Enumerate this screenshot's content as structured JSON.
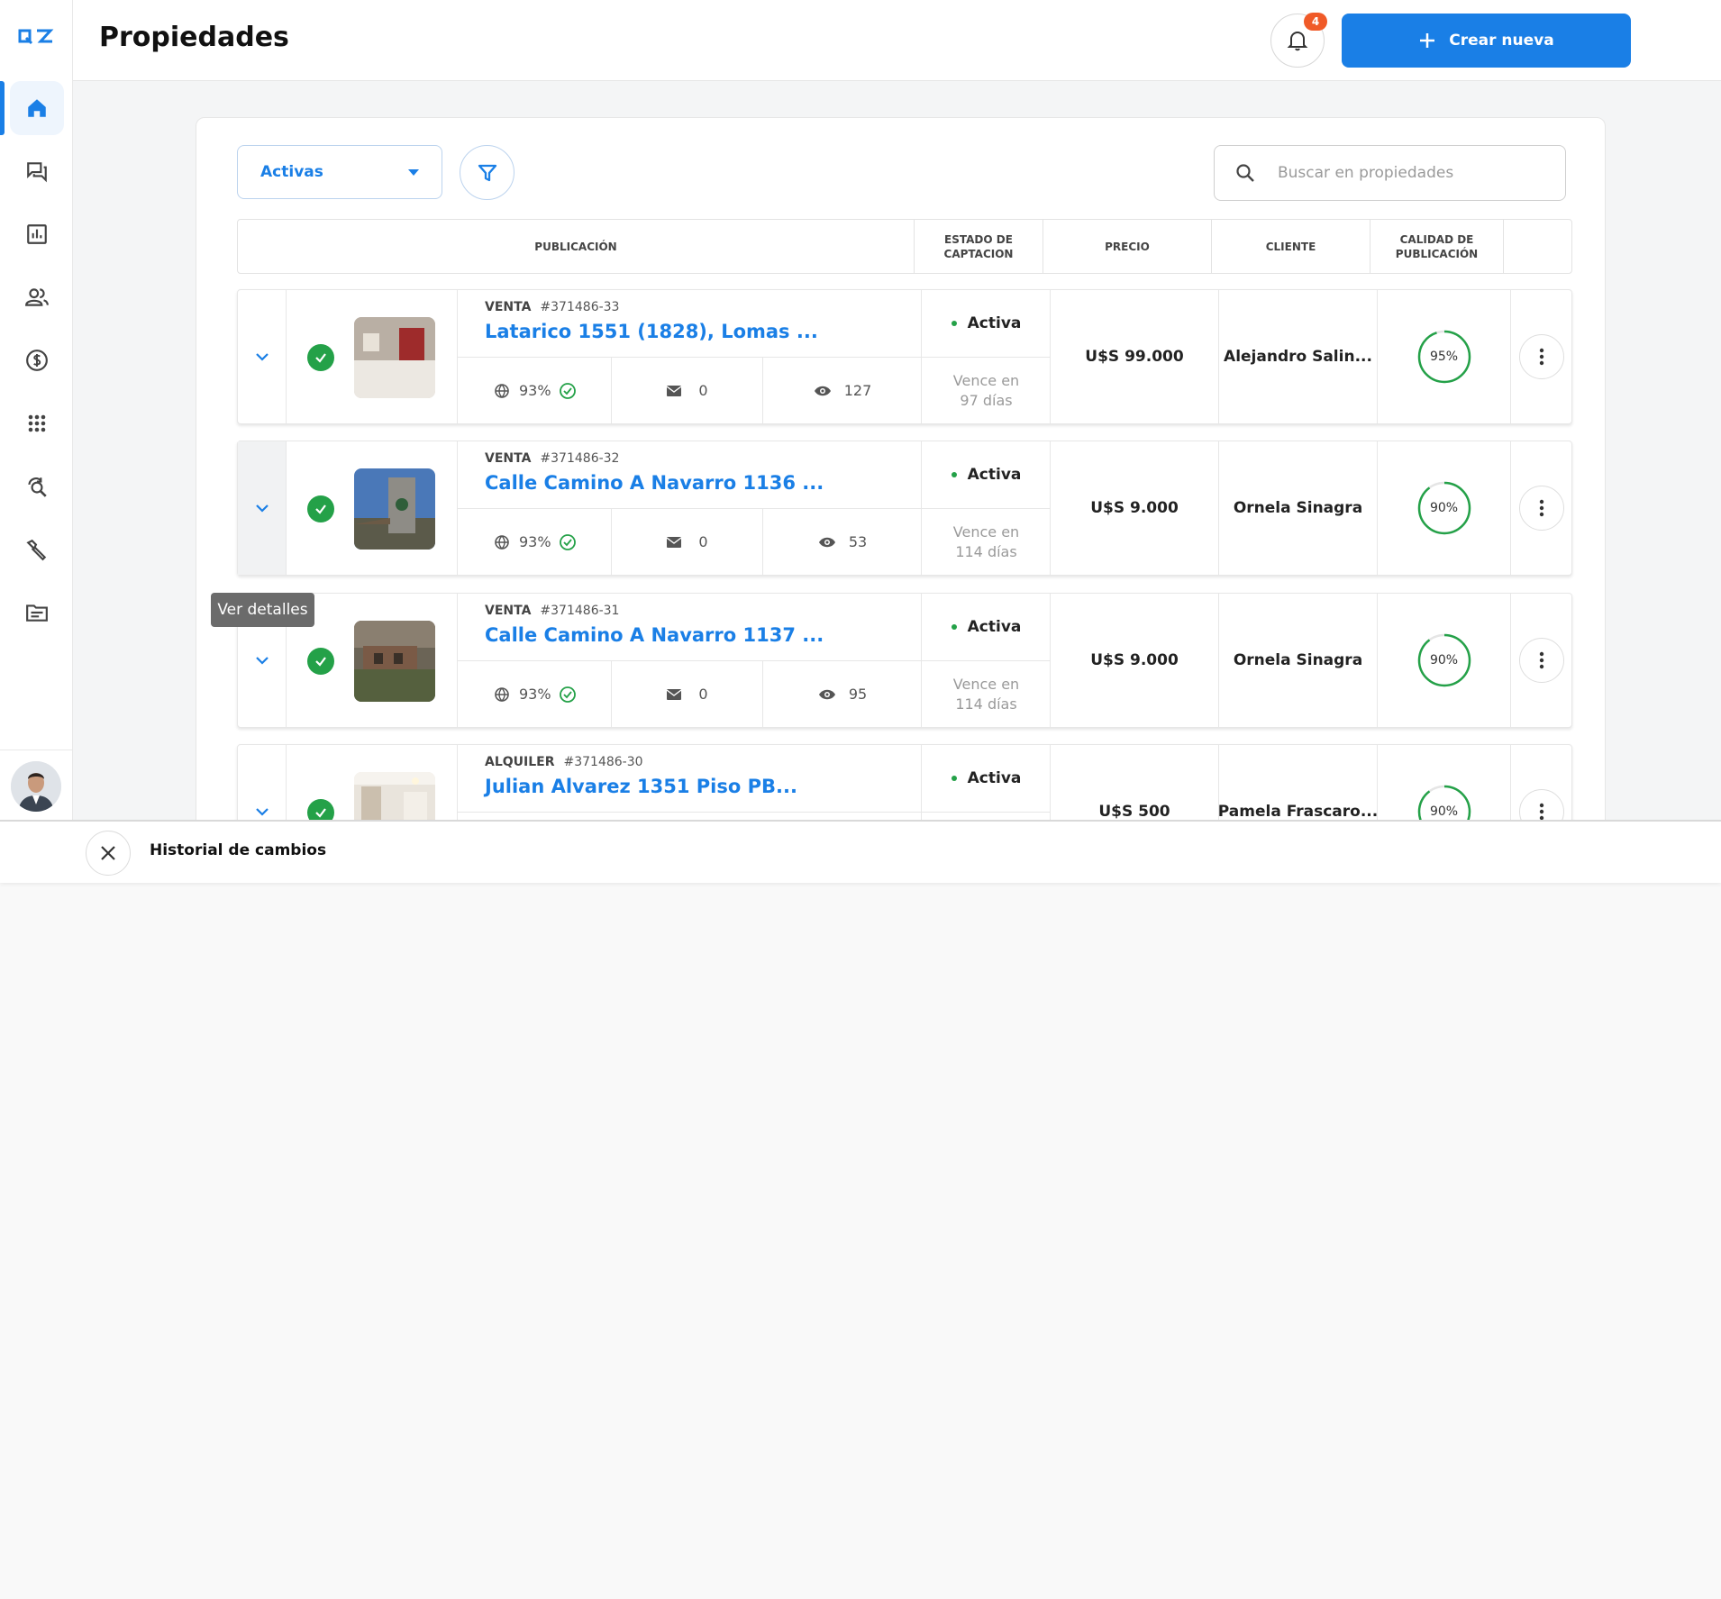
{
  "header": {
    "title": "Propiedades",
    "notifications_count": "4",
    "create_label": "Crear nueva"
  },
  "sidebar": {
    "items": [
      {
        "icon": "home-icon",
        "active": true
      },
      {
        "icon": "chat-icon"
      },
      {
        "icon": "reports-icon"
      },
      {
        "icon": "contacts-icon"
      },
      {
        "icon": "dollar-icon"
      },
      {
        "icon": "apps-icon"
      },
      {
        "icon": "search-sync-icon"
      },
      {
        "icon": "tools-icon"
      },
      {
        "icon": "documents-icon"
      }
    ]
  },
  "toolbar": {
    "status_filter": "Activas",
    "search_placeholder": "Buscar en propiedades"
  },
  "table": {
    "columns": [
      "PUBLICACIÓN",
      "ESTADO DE CAPTACION",
      "PRECIO",
      "CLIENTE",
      "CALIDAD DE PUBLICACIÓN"
    ],
    "rows": [
      {
        "operation": "VENTA",
        "code": "#371486-33",
        "address": "Latarico 1551 (1828), Lomas ...",
        "quality_web": "93%",
        "messages": "0",
        "views": "127",
        "status": "Activa",
        "expires_line1": "Vence en",
        "expires_line2": "97 días",
        "price": "U$S 99.000",
        "client": "Alejandro Salin...",
        "quality": "95%"
      },
      {
        "operation": "VENTA",
        "code": "#371486-32",
        "address": "Calle Camino A Navarro 1136 ...",
        "quality_web": "93%",
        "messages": "0",
        "views": "53",
        "status": "Activa",
        "expires_line1": "Vence en",
        "expires_line2": "114 días",
        "price": "U$S 9.000",
        "client": "Ornela Sinagra",
        "quality": "90%"
      },
      {
        "operation": "VENTA",
        "code": "#371486-31",
        "address": "Calle Camino A Navarro 1137 ...",
        "quality_web": "93%",
        "messages": "0",
        "views": "95",
        "status": "Activa",
        "expires_line1": "Vence en",
        "expires_line2": "114 días",
        "price": "U$S 9.000",
        "client": "Ornela Sinagra",
        "quality": "90%"
      },
      {
        "operation": "ALQUILER",
        "code": "#371486-30",
        "address": "Julian Alvarez 1351 Piso PB...",
        "quality_web": "",
        "messages": "",
        "views": "",
        "status": "Activa",
        "expires_line1": "",
        "expires_line2": "",
        "price": "U$S 500",
        "client": "Pamela Frascaro...",
        "quality": "90%"
      }
    ]
  },
  "tooltip": "Ver detalles",
  "bottom_panel": {
    "title": "Historial de cambios"
  },
  "colors": {
    "primary": "#1a7fe6",
    "success": "#24a148",
    "badge": "#f05a28"
  }
}
